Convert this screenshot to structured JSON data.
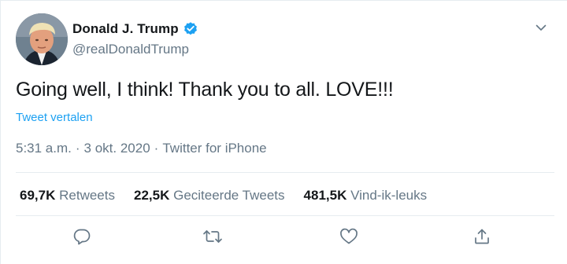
{
  "tweet": {
    "display_name": "Donald J. Trump",
    "handle": "@realDonaldTrump",
    "text": "Going well, I think! Thank you to all. LOVE!!!",
    "translate_label": "Tweet vertalen",
    "time": "5:31 a.m.",
    "date": "3 okt. 2020",
    "source": "Twitter for iPhone",
    "separator": "·"
  },
  "stats": [
    {
      "count": "69,7K",
      "label": "Retweets"
    },
    {
      "count": "22,5K",
      "label": "Geciteerde Tweets"
    },
    {
      "count": "481,5K",
      "label": "Vind-ik-leuks"
    }
  ],
  "icons": {
    "verified": "verified-badge-icon",
    "more": "chevron-down-icon",
    "reply": "reply-icon",
    "retweet": "retweet-icon",
    "like": "heart-icon",
    "share": "share-icon"
  },
  "colors": {
    "accent": "#1da1f2",
    "text_primary": "#14171a",
    "text_secondary": "#657786",
    "border": "#e6ecf0"
  }
}
